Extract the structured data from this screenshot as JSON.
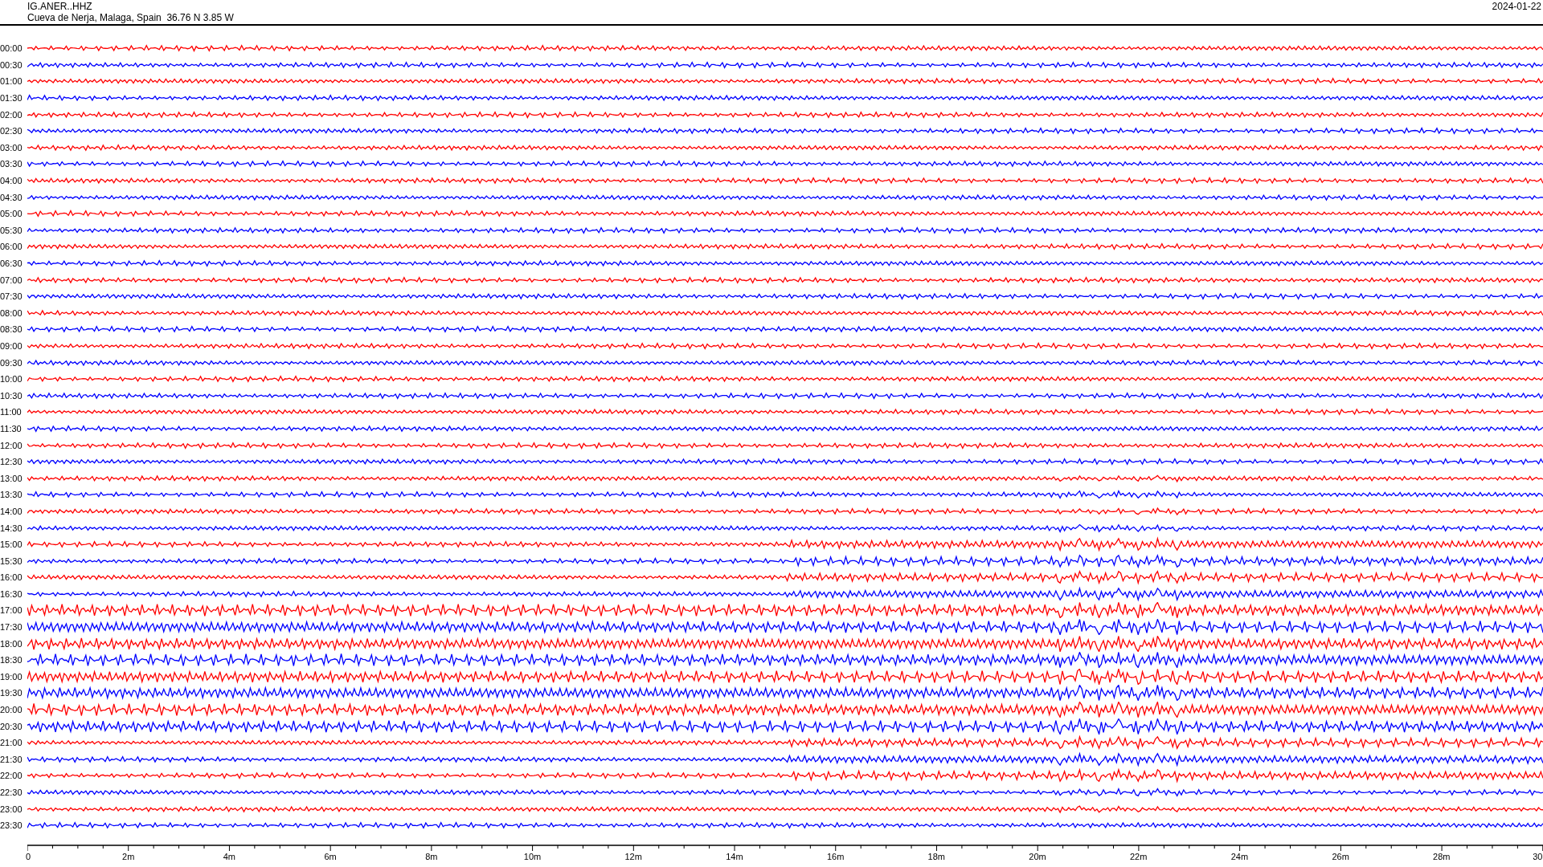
{
  "header": {
    "station": "IG.ANER..HHZ",
    "location": "Cueva de Nerja, Malaga, Spain  36.76 N 3.85 W",
    "date": "2024-01-22"
  },
  "traces": [
    {
      "label": "00:00",
      "color": "#ff0000"
    },
    {
      "label": "00:30",
      "color": "#0000ff"
    },
    {
      "label": "01:00",
      "color": "#ff0000"
    },
    {
      "label": "01:30",
      "color": "#0000ff"
    },
    {
      "label": "02:00",
      "color": "#ff0000"
    },
    {
      "label": "02:30",
      "color": "#0000ff"
    },
    {
      "label": "03:00",
      "color": "#ff0000"
    },
    {
      "label": "03:30",
      "color": "#0000ff"
    },
    {
      "label": "04:00",
      "color": "#ff0000"
    },
    {
      "label": "04:30",
      "color": "#0000ff"
    },
    {
      "label": "05:00",
      "color": "#ff0000"
    },
    {
      "label": "05:30",
      "color": "#0000ff"
    },
    {
      "label": "06:00",
      "color": "#ff0000"
    },
    {
      "label": "06:30",
      "color": "#0000ff"
    },
    {
      "label": "07:00",
      "color": "#ff0000"
    },
    {
      "label": "07:30",
      "color": "#0000ff"
    },
    {
      "label": "08:00",
      "color": "#ff0000"
    },
    {
      "label": "08:30",
      "color": "#0000ff"
    },
    {
      "label": "09:00",
      "color": "#ff0000"
    },
    {
      "label": "09:30",
      "color": "#0000ff"
    },
    {
      "label": "10:00",
      "color": "#ff0000"
    },
    {
      "label": "10:30",
      "color": "#0000ff"
    },
    {
      "label": "11:00",
      "color": "#ff0000"
    },
    {
      "label": "11:30",
      "color": "#0000ff"
    },
    {
      "label": "12:00",
      "color": "#ff0000"
    },
    {
      "label": "12:30",
      "color": "#0000ff"
    },
    {
      "label": "13:00",
      "color": "#ff0000"
    },
    {
      "label": "13:30",
      "color": "#0000ff"
    },
    {
      "label": "14:00",
      "color": "#ff0000"
    },
    {
      "label": "14:30",
      "color": "#0000ff"
    },
    {
      "label": "15:00",
      "color": "#ff0000"
    },
    {
      "label": "15:30",
      "color": "#0000ff"
    },
    {
      "label": "16:00",
      "color": "#ff0000"
    },
    {
      "label": "16:30",
      "color": "#0000ff"
    },
    {
      "label": "17:00",
      "color": "#ff0000"
    },
    {
      "label": "17:30",
      "color": "#0000ff"
    },
    {
      "label": "18:00",
      "color": "#ff0000"
    },
    {
      "label": "18:30",
      "color": "#0000ff"
    },
    {
      "label": "19:00",
      "color": "#ff0000"
    },
    {
      "label": "19:30",
      "color": "#0000ff"
    },
    {
      "label": "20:00",
      "color": "#ff0000"
    },
    {
      "label": "20:30",
      "color": "#0000ff"
    },
    {
      "label": "21:00",
      "color": "#ff0000"
    },
    {
      "label": "21:30",
      "color": "#0000ff"
    },
    {
      "label": "22:00",
      "color": "#ff0000"
    },
    {
      "label": "22:30",
      "color": "#0000ff"
    },
    {
      "label": "23:00",
      "color": "#ff0000"
    },
    {
      "label": "23:30",
      "color": "#0000ff"
    }
  ],
  "x_axis": {
    "ticks": [
      "0",
      "2m",
      "4m",
      "6m",
      "8m",
      "10m",
      "12m",
      "14m",
      "16m",
      "18m",
      "20m",
      "22m",
      "24m",
      "26m",
      "28m",
      "30"
    ]
  }
}
